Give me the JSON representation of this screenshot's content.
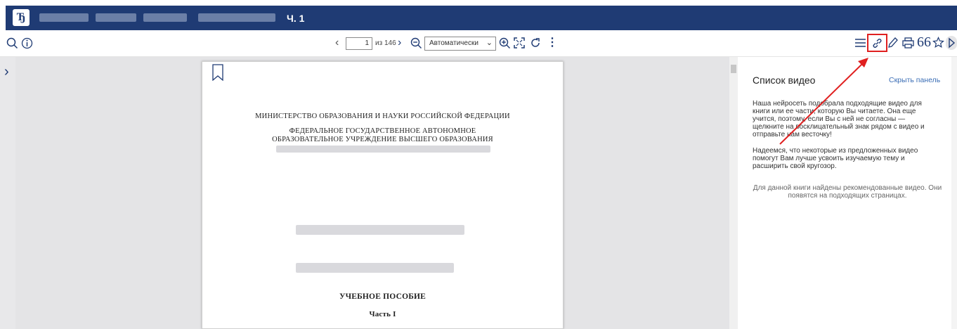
{
  "header": {
    "title_part": "Ч. 1"
  },
  "toolbar": {
    "page_value": "1",
    "page_of": "из 146",
    "zoom_value": "Автоматически"
  },
  "document": {
    "line1": "МИНИСТЕРСТВО ОБРАЗОВАНИЯ И НАУКИ РОССИЙСКОЙ ФЕДЕРАЦИИ",
    "line2": "ФЕДЕРАЛЬНОЕ ГОСУДАРСТВЕННОЕ АВТОНОМНОЕ",
    "line3": "ОБРАЗОВАТЕЛЬНОЕ УЧРЕЖДЕНИЕ ВЫСШЕГО ОБРАЗОВАНИЯ",
    "heading": "УЧЕБНОЕ ПОСОБИЕ",
    "part": "Часть I"
  },
  "panel": {
    "title": "Список видео",
    "hide_label": "Скрыть панель",
    "para1": "Наша нейросеть подобрала подходящие видео для книги или ее части, которую Вы читаете. Она еще учится, поэтому, если Вы с ней не согласны — щелкните на восклицательный знак рядом с видео и отправьте нам весточку!",
    "para2": "Надеемся, что некоторые из предложенных видео помогут Вам лучше усвоить изучаемую тему и расширить свой кругозор.",
    "note": "Для данной книги найдены рекомендованные видео. Они появятся на подходящих страницах."
  },
  "colors": {
    "header_bg": "#1f3b74",
    "icon": "#1f3b74",
    "highlight": "#e02020",
    "link": "#3a6db5"
  },
  "icons": [
    "search-icon",
    "info-icon",
    "chevron-left-icon",
    "chevron-right-icon",
    "zoom-out-icon",
    "zoom-in-icon",
    "fullscreen-icon",
    "rotate-icon",
    "more-icon",
    "toc-icon",
    "link-icon",
    "pen-icon",
    "print-icon",
    "quote-icon",
    "star-icon",
    "panel-toggle-icon",
    "bookmark-icon"
  ]
}
